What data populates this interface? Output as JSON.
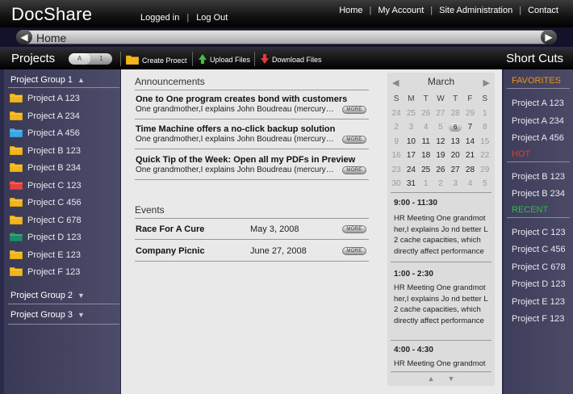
{
  "app": {
    "logo": "DocShare",
    "logged_in": "Logged in",
    "logout": "Log Out",
    "nav": [
      "Home",
      "My Account",
      "Site Administration",
      "Contact"
    ]
  },
  "breadcrumb": {
    "text": "Home",
    "left_icon": "chevron-left-icon",
    "right_icon": "chevron-right-icon"
  },
  "toolbar": {
    "projects_label": "Projects",
    "toggle_a": "A",
    "toggle_b": "1",
    "create_project": "Create Proect",
    "upload_files": "Upload Files",
    "download_files": "Download Files",
    "shortcuts_label": "Short Cuts"
  },
  "sidebar": {
    "group1": "Project Group 1",
    "group2": "Project Group 2",
    "group3": "Project Group 3",
    "projects": [
      {
        "label": "Project A 123",
        "color": "#f2b51a"
      },
      {
        "label": "Project A 234",
        "color": "#f2b51a"
      },
      {
        "label": "Project A 456",
        "color": "#3aa8e6"
      },
      {
        "label": "Project B 123",
        "color": "#f2b51a"
      },
      {
        "label": "Project B 234",
        "color": "#f2b51a"
      },
      {
        "label": "Project C 123",
        "color": "#e84040"
      },
      {
        "label": "Project C 456",
        "color": "#f2b51a"
      },
      {
        "label": "Project C 678",
        "color": "#f2b51a"
      },
      {
        "label": "Project D 123",
        "color": "#1f8a6a"
      },
      {
        "label": "Project E 123",
        "color": "#f2b51a"
      },
      {
        "label": "Project F 123",
        "color": "#f2b51a"
      }
    ]
  },
  "announcements": {
    "title": "Announcements",
    "more_label": "MORE",
    "items": [
      {
        "title": "One to One program creates bond with customers",
        "desc": "One grandmother,I explains John Boudreau (mercurynews...."
      },
      {
        "title": "Time Machine offers a no-click backup solution",
        "desc": "One grandmother,I explains John Boudreau (mercurynews...."
      },
      {
        "title": "Quick Tip of the Week: Open all my PDFs in Preview",
        "desc": "One grandmother,I explains John Boudreau (mercurynews...."
      }
    ]
  },
  "events": {
    "title": "Events",
    "items": [
      {
        "name": "Race For A Cure",
        "date": "May 3, 2008"
      },
      {
        "name": "Company Picnic",
        "date": "June 27, 2008"
      }
    ]
  },
  "calendar": {
    "month": "March",
    "days": [
      "S",
      "M",
      "T",
      "W",
      "T",
      "F",
      "S"
    ],
    "weeks": [
      [
        {
          "d": "24",
          "dim": true
        },
        {
          "d": "25",
          "dim": true
        },
        {
          "d": "26",
          "dim": true
        },
        {
          "d": "27",
          "dim": true
        },
        {
          "d": "28",
          "dim": true
        },
        {
          "d": "29",
          "dim": true
        },
        {
          "d": "1",
          "dim": true
        }
      ],
      [
        {
          "d": "2",
          "dim": true
        },
        {
          "d": "3",
          "dim": true
        },
        {
          "d": "4",
          "dim": true
        },
        {
          "d": "5",
          "dim": true
        },
        {
          "d": "6",
          "today": true
        },
        {
          "d": "7"
        },
        {
          "d": "8",
          "dim": true
        }
      ],
      [
        {
          "d": "9",
          "dim": true
        },
        {
          "d": "10"
        },
        {
          "d": "11"
        },
        {
          "d": "12"
        },
        {
          "d": "13"
        },
        {
          "d": "14"
        },
        {
          "d": "15",
          "dim": true
        }
      ],
      [
        {
          "d": "16",
          "dim": true
        },
        {
          "d": "17"
        },
        {
          "d": "18"
        },
        {
          "d": "19"
        },
        {
          "d": "20"
        },
        {
          "d": "21"
        },
        {
          "d": "22",
          "dim": true
        }
      ],
      [
        {
          "d": "23",
          "dim": true
        },
        {
          "d": "24"
        },
        {
          "d": "25"
        },
        {
          "d": "26"
        },
        {
          "d": "27"
        },
        {
          "d": "28"
        },
        {
          "d": "29",
          "dim": true
        }
      ],
      [
        {
          "d": "30",
          "dim": true
        },
        {
          "d": "31"
        },
        {
          "d": "1",
          "dim": true
        },
        {
          "d": "2",
          "dim": true
        },
        {
          "d": "3",
          "dim": true
        },
        {
          "d": "4",
          "dim": true
        },
        {
          "d": "5",
          "dim": true
        }
      ]
    ]
  },
  "agenda": [
    {
      "time": "9:00 - 11:30",
      "desc": "HR Meeting One grandmot her,I explains Jo nd better L 2 cache capacities, which directly affect performance"
    },
    {
      "time": "1:00 - 2:30",
      "desc": "HR Meeting One grandmot her,I explains Jo nd better L 2 cache capacities, which directly affect performance"
    },
    {
      "time": "4:00 - 4:30",
      "desc": "HR Meeting One grandmot"
    }
  ],
  "shortcuts": {
    "favorites_label": "FAVORITES",
    "favorites_color": "#e8961a",
    "favorites": [
      "Project A 123",
      "Project A 234",
      "Project A 456"
    ],
    "hot_label": "HOT",
    "hot_color": "#d8402a",
    "hot": [
      "Project B 123",
      "Project B 234"
    ],
    "recent_label": "RECENT",
    "recent_color": "#2fbf3a",
    "recent": [
      "Project C 123",
      "Project C 456",
      "Project C 678",
      "Project D 123",
      "Project E 123",
      "Project F 123"
    ]
  }
}
